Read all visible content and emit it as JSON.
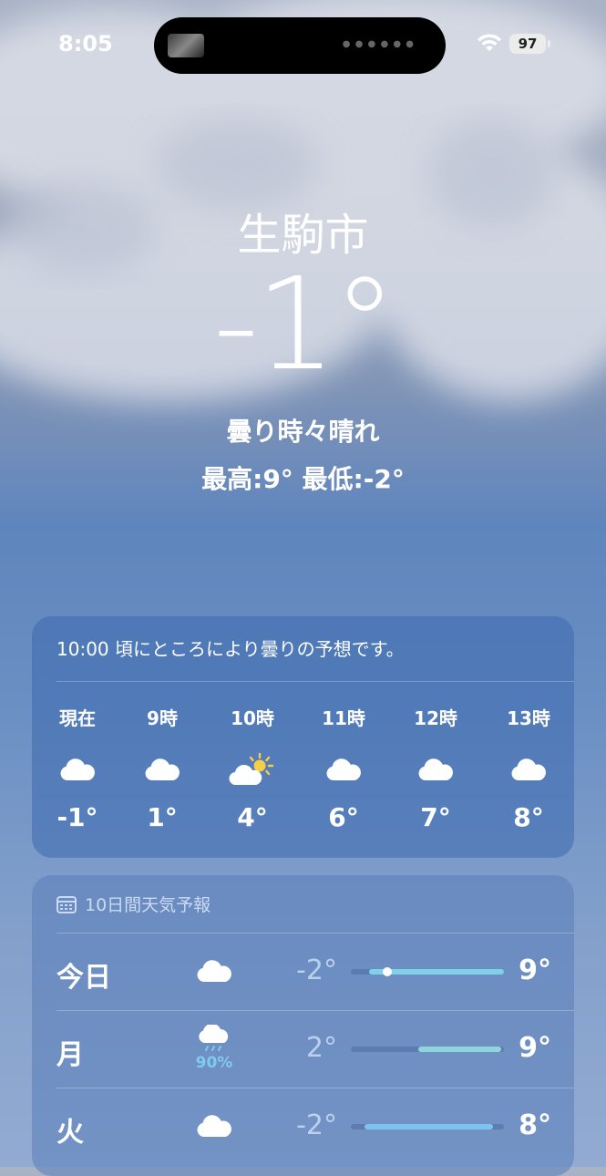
{
  "status": {
    "time": "8:05",
    "battery": "97"
  },
  "location": {
    "city": "生駒市",
    "temperature": "-1°",
    "condition": "曇り時々晴れ",
    "high_low": "最高:9°  最低:-2°"
  },
  "hourly": {
    "summary": "10:00 頃にところにより曇りの予想です。",
    "hours": [
      {
        "label": "現在",
        "icon": "cloud-icon",
        "temp": "-1°"
      },
      {
        "label": "9時",
        "icon": "cloud-icon",
        "temp": "1°"
      },
      {
        "label": "10時",
        "icon": "partly-sunny-icon",
        "temp": "4°"
      },
      {
        "label": "11時",
        "icon": "cloud-icon",
        "temp": "6°"
      },
      {
        "label": "12時",
        "icon": "cloud-icon",
        "temp": "7°"
      },
      {
        "label": "13時",
        "icon": "cloud-icon",
        "temp": "8°"
      }
    ]
  },
  "daily": {
    "header": "10日間天気予報",
    "days": [
      {
        "name": "今日",
        "icon": "cloud-icon",
        "precip": "",
        "low": "-2°",
        "high": "9°",
        "range_start": 0.12,
        "range_end": 1.0,
        "current": 0.24
      },
      {
        "name": "月",
        "icon": "rain-cloud-icon",
        "precip": "90%",
        "low": "2°",
        "high": "9°",
        "range_start": 0.44,
        "range_end": 0.98
      },
      {
        "name": "火",
        "icon": "cloud-icon",
        "precip": "",
        "low": "-2°",
        "high": "8°",
        "range_start": 0.09,
        "range_end": 0.93
      }
    ]
  },
  "colors": {
    "bar_today": "#7fd0e8",
    "bar_mon": "#8fd6dc",
    "bar_tue": "#7cc4ef",
    "sun": "#f7ce46",
    "precip": "#7ecbf2"
  }
}
